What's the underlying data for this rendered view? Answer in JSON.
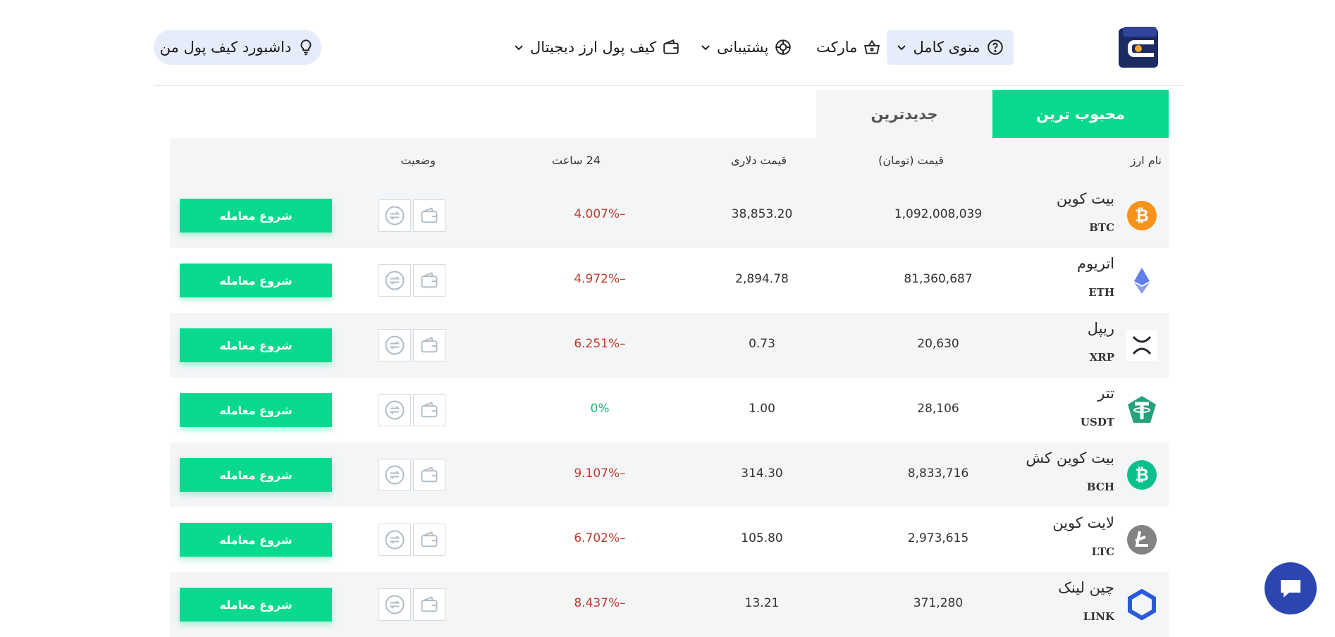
{
  "header": {
    "nav": {
      "full_menu": "منوی کامل",
      "market": "مارکت",
      "support": "پشتیبانی",
      "wallet": "کیف پول ارز دیجیتال"
    },
    "dashboard_button": "داشبورد کیف پول من"
  },
  "tabs": {
    "popular": "محبوب ترین",
    "newest": "جدیدترین",
    "active": "popular"
  },
  "table": {
    "columns": {
      "name": "نام ارز",
      "toman": "قیمت (تومان)",
      "usd": "قیمت دلاری",
      "change": "24 ساعت",
      "status": "وضعیت"
    },
    "trade_label": "شروع معامله",
    "rows": [
      {
        "name": "بیت کوین",
        "symbol": "BTC",
        "toman": "1,092,008,039",
        "usd": "38,853.20",
        "change": "4.007%–",
        "trend": "down",
        "icon": "bitcoin-icon",
        "color": "#f7931a"
      },
      {
        "name": "اتریوم",
        "symbol": "ETH",
        "toman": "81,360,687",
        "usd": "2,894.78",
        "change": "4.972%–",
        "trend": "down",
        "icon": "ethereum-icon",
        "color": "#627eea"
      },
      {
        "name": "ریپل",
        "symbol": "XRP",
        "toman": "20,630",
        "usd": "0.73",
        "change": "6.251%–",
        "trend": "down",
        "icon": "ripple-icon",
        "color": "#23292f"
      },
      {
        "name": "تتر",
        "symbol": "USDT",
        "toman": "28,106",
        "usd": "1.00",
        "change": "0%",
        "trend": "flat",
        "icon": "tether-icon",
        "color": "#26a17b"
      },
      {
        "name": "بیت کوین کش",
        "symbol": "BCH",
        "toman": "8,833,716",
        "usd": "314.30",
        "change": "9.107%–",
        "trend": "down",
        "icon": "bitcoin-cash-icon",
        "color": "#0ac18e"
      },
      {
        "name": "لایت کوین",
        "symbol": "LTC",
        "toman": "2,973,615",
        "usd": "105.80",
        "change": "6.702%–",
        "trend": "down",
        "icon": "litecoin-icon",
        "color": "#838383"
      },
      {
        "name": "چین لینک",
        "symbol": "LINK",
        "toman": "371,280",
        "usd": "13.21",
        "change": "8.437%–",
        "trend": "down",
        "icon": "chainlink-icon",
        "color": "#2a5ada"
      }
    ]
  },
  "colors": {
    "accent": "#08d98f",
    "negative": "#c0392b",
    "positive": "#19b877",
    "chat": "#2b46b0"
  }
}
